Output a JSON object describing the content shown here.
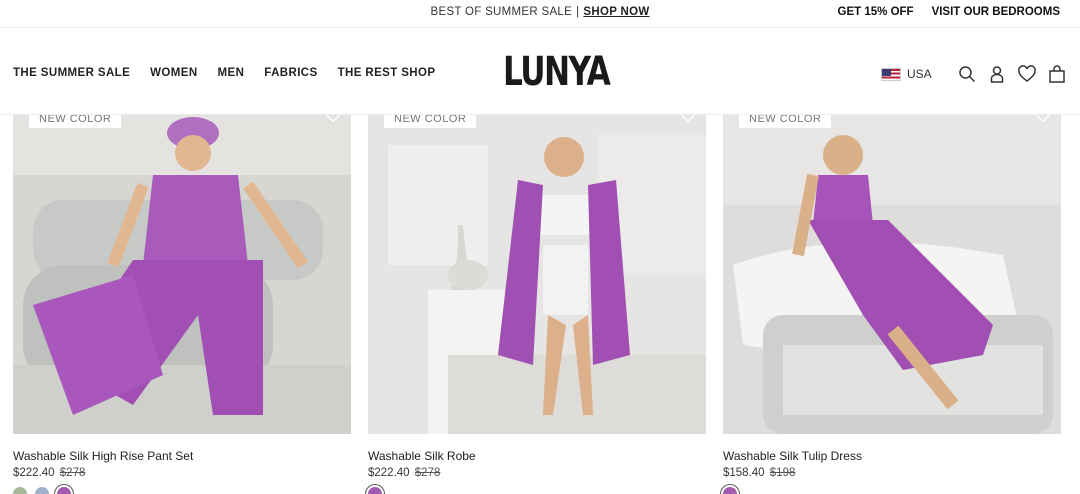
{
  "announcement": {
    "promo_text": "BEST OF SUMMER SALE",
    "separator": "|",
    "promo_link": "SHOP NOW",
    "right_links": [
      "GET 15% OFF",
      "VISIT OUR BEDROOMS"
    ]
  },
  "header": {
    "nav": [
      "THE SUMMER SALE",
      "WOMEN",
      "MEN",
      "FABRICS",
      "THE REST SHOP"
    ],
    "logo": "LUNYA",
    "locale": "USA",
    "icons": [
      "search-icon",
      "account-icon",
      "wishlist-heart-icon",
      "cart-bag-icon"
    ]
  },
  "products": [
    {
      "badge": "NEW COLOR",
      "name": "Washable Silk High Rise Pant Set",
      "price": "$222.40",
      "original_price": "$278",
      "swatches": [
        "#a9b79a",
        "#9fb4cc",
        "#a35bb2"
      ]
    },
    {
      "badge": "NEW COLOR",
      "name": "Washable Silk Robe",
      "price": "$222.40",
      "original_price": "$278",
      "swatches": [
        "#a35bb2"
      ]
    },
    {
      "badge": "NEW COLOR",
      "name": "Washable Silk Tulip Dress",
      "price": "$158.40",
      "original_price": "$198",
      "swatches": [
        "#a35bb2"
      ]
    }
  ]
}
